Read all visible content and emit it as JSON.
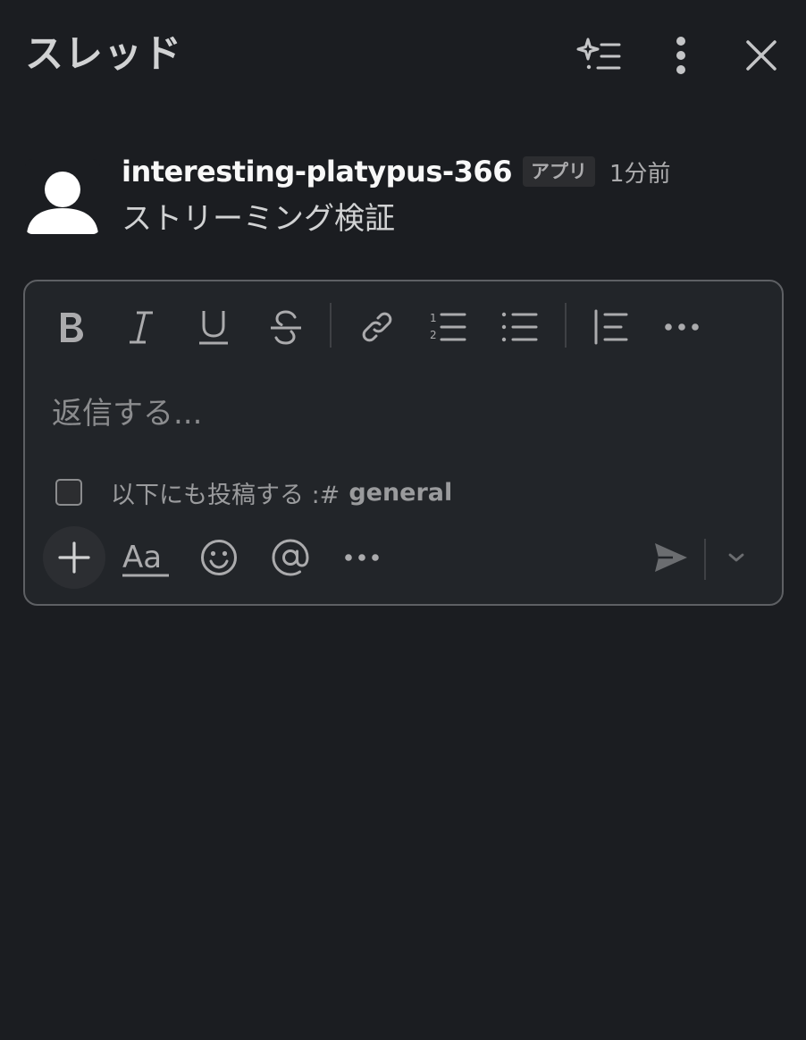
{
  "header": {
    "title": "スレッド",
    "icons": [
      "sparkle-list-icon",
      "more-vertical-icon",
      "close-icon"
    ]
  },
  "message": {
    "username": "interesting-platypus-366",
    "badge": "アプリ",
    "timestamp": "1分前",
    "text": "ストリーミング検証"
  },
  "composer": {
    "toolbar": [
      "bold-icon",
      "italic-icon",
      "underline-icon",
      "strikethrough-icon",
      "link-icon",
      "numbered-list-icon",
      "bulleted-list-icon",
      "blockquote-icon",
      "more-horizontal-icon"
    ],
    "placeholder": "返信する...",
    "also_post_label": "以下にも投稿する :#",
    "also_post_channel": "general",
    "also_post_checked": false,
    "bottom_actions": [
      "plus-icon",
      "text-format-icon",
      "emoji-icon",
      "mention-icon",
      "more-horizontal-icon",
      "send-icon",
      "chevron-down-icon"
    ]
  },
  "colors": {
    "background": "#1b1d21",
    "composer_bg": "#222529",
    "border": "#5e6064",
    "text_primary": "#f8f8f8",
    "text_secondary": "#ababad"
  }
}
